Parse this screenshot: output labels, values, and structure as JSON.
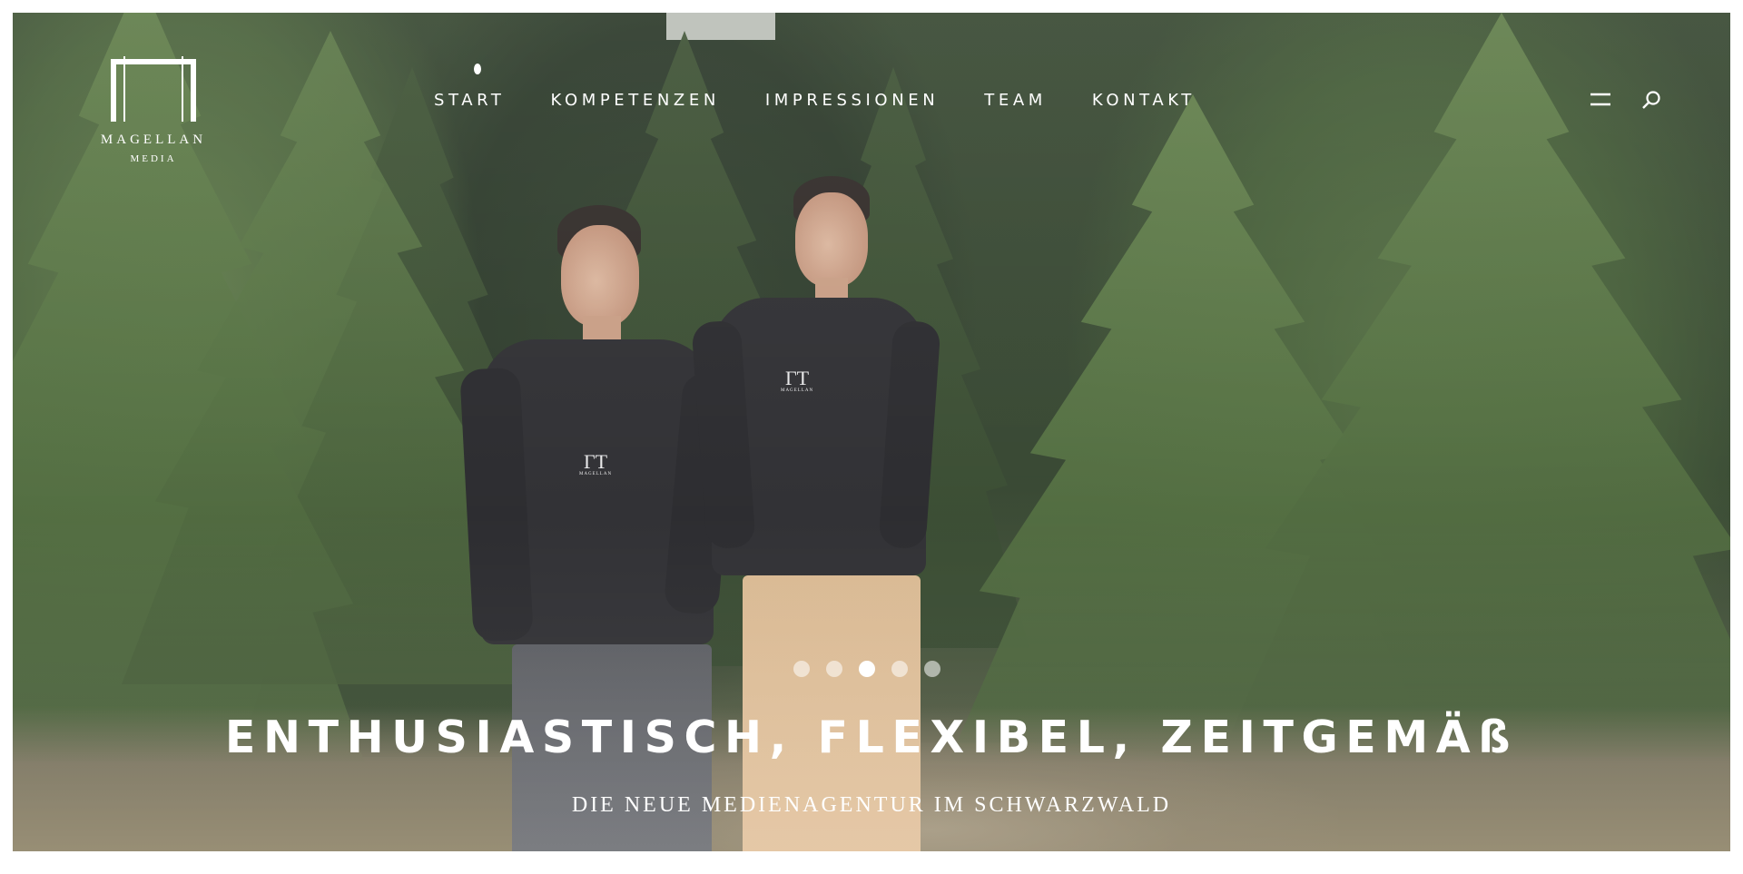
{
  "logo": {
    "name": "MAGELLAN",
    "sub": "MEDIA"
  },
  "nav": {
    "items": [
      {
        "label": "START",
        "active": true
      },
      {
        "label": "KOMPETENZEN",
        "active": false
      },
      {
        "label": "IMPRESSIONEN",
        "active": false
      },
      {
        "label": "TEAM",
        "active": false
      },
      {
        "label": "KONTAKT",
        "active": false
      }
    ]
  },
  "header_icons": [
    "menu-icon",
    "search-icon"
  ],
  "slider": {
    "slide_count": 5,
    "active_slide": 3
  },
  "hero": {
    "headline": "ENTHUSIASTISCH, FLEXIBEL, ZEITGEMÄß",
    "subline": "DIE NEUE MEDIENAGENTUR IM SCHWARZWALD"
  },
  "colors": {
    "text": "#ffffff",
    "background": "#ffffff",
    "foliage": "#4d6a3a"
  }
}
